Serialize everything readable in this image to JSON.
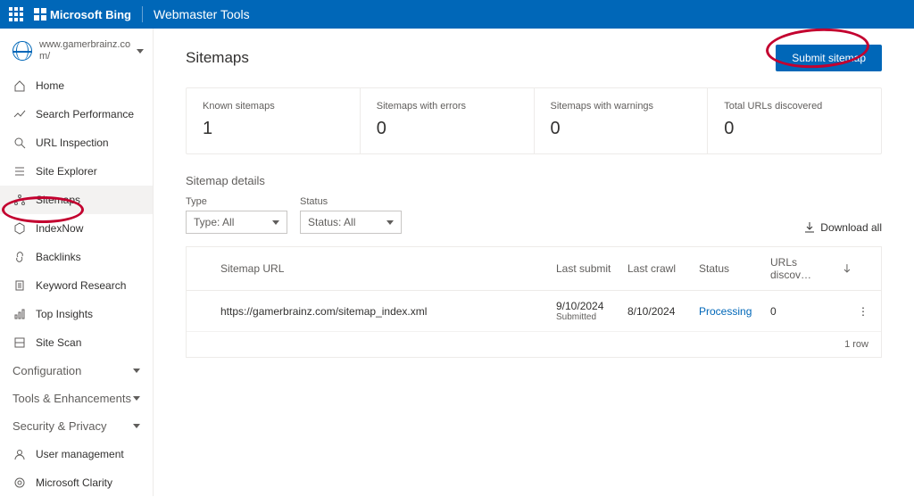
{
  "header": {
    "brand": "Microsoft Bing",
    "tool": "Webmaster Tools"
  },
  "sidebar": {
    "site_name": "www.gamerbrainz.com/",
    "items": [
      {
        "label": "Home",
        "icon": "home"
      },
      {
        "label": "Search Performance",
        "icon": "trend"
      },
      {
        "label": "URL Inspection",
        "icon": "search"
      },
      {
        "label": "Site Explorer",
        "icon": "list"
      },
      {
        "label": "Sitemaps",
        "icon": "sitemap",
        "active": true
      },
      {
        "label": "IndexNow",
        "icon": "hex"
      },
      {
        "label": "Backlinks",
        "icon": "link"
      },
      {
        "label": "Keyword Research",
        "icon": "page"
      },
      {
        "label": "Top Insights",
        "icon": "insight"
      },
      {
        "label": "Site Scan",
        "icon": "scan"
      }
    ],
    "sections": [
      {
        "label": "Configuration"
      },
      {
        "label": "Tools & Enhancements"
      },
      {
        "label": "Security & Privacy"
      }
    ],
    "sub_items": [
      {
        "label": "User management",
        "icon": "user"
      },
      {
        "label": "Microsoft Clarity",
        "icon": "clarity"
      }
    ]
  },
  "page": {
    "title": "Sitemaps",
    "submit_label": "Submit sitemap"
  },
  "stats": [
    {
      "label": "Known sitemaps",
      "value": "1"
    },
    {
      "label": "Sitemaps with errors",
      "value": "0"
    },
    {
      "label": "Sitemaps with warnings",
      "value": "0"
    },
    {
      "label": "Total URLs discovered",
      "value": "0"
    }
  ],
  "details": {
    "title": "Sitemap details",
    "type_label": "Type",
    "type_value": "Type: All",
    "status_label": "Status",
    "status_value": "Status: All",
    "download": "Download all",
    "columns": {
      "url": "Sitemap URL",
      "last_submit": "Last submit",
      "last_crawl": "Last crawl",
      "status": "Status",
      "urls": "URLs discov…"
    },
    "rows": [
      {
        "url": "https://gamerbrainz.com/sitemap_index.xml",
        "last_submit": "9/10/2024",
        "last_submit_sub": "Submitted",
        "last_crawl": "8/10/2024",
        "status": "Processing",
        "urls": "0"
      }
    ],
    "footer": "1 row"
  }
}
